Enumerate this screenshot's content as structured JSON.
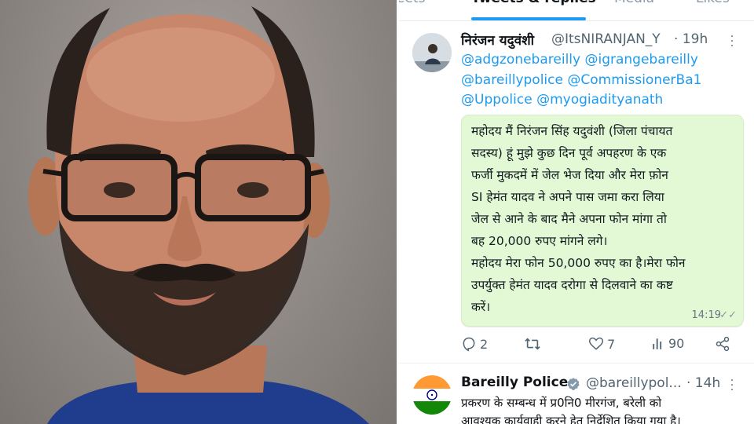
{
  "tabs": {
    "replies_partial": "eets",
    "tweets_replies": "Tweets & replies",
    "media": "Media",
    "likes": "Likes"
  },
  "tweet": {
    "author_name": "निरंजन यदुवंशी",
    "handle": "@ItsNIRANJAN_Y",
    "time": "· 19h",
    "mentions": [
      "@adgzonebareilly @igrangebareilly",
      "@bareillypolice @CommissionerBa1",
      "@Uppolice @myogiadityanath"
    ],
    "message_lines": [
      "महोदय मैं निरंजन सिंह यदुवंशी (जिला पंचायत",
      "सदस्य) हूं मुझे कुछ दिन पूर्व अपहरण के एक",
      "फर्जी मुकदमें में जेल भेज दिया और मेरा फ़ोन",
      "SI हेमंत यादव ने अपने पास जमा करा लिया",
      "जेल से आने के बाद मैने अपना फोन मांगा तो",
      "बह 20,000 रुपए मांगने लगे।",
      "महोदय मेरा फोन 50,000 रुपए का है।मेरा फोन",
      "उपर्युक्त हेमंत यादव दरोगा से दिलवाने का कष्ट",
      "करें।"
    ],
    "message_time": "14:19",
    "stats": {
      "replies": "2",
      "retweets": "",
      "likes": "7",
      "views": "90"
    }
  },
  "reply_tweet": {
    "author_name": "Bareilly Police",
    "handle": "@bareillypol...",
    "time": "· 14h",
    "text_lines": [
      "प्रकरण के सम्बन्ध में प्र0नि0 मीरगंज, बरेली को",
      "आवश्यक कार्यवाही करने हेतु निर्देशित किया गया है।"
    ]
  },
  "colors": {
    "link": "#1d9bf0",
    "bubble": "#e3f8d4",
    "verified": "#829aab",
    "saffron": "#ff9933",
    "green": "#138808"
  }
}
